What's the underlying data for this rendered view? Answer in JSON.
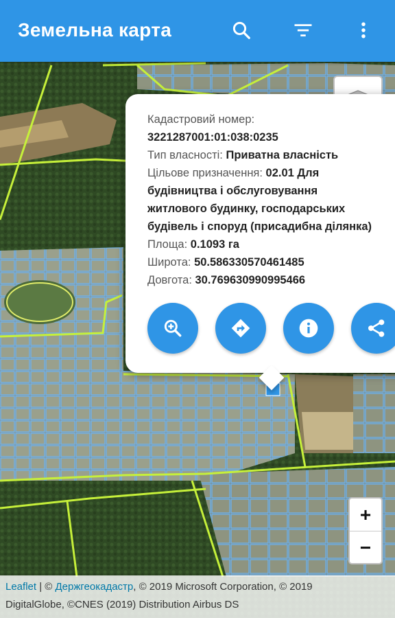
{
  "appbar": {
    "title": "Земельна карта",
    "icons": [
      "search-icon",
      "filter-icon",
      "more-vert-icon"
    ],
    "color": "#2f95e6"
  },
  "popup": {
    "cadastral_label": "Кадастровий номер:",
    "cadastral_number": "3221287001:01:038:0235",
    "ownership_label": "Тип власності:",
    "ownership_value": "Приватна власність",
    "purpose_label": "Цільове призначення:",
    "purpose_line1": "02.01 Для",
    "purpose_line2": "будівництва і обслуговування",
    "purpose_line3": "житлового будинку, господарських",
    "purpose_line4": "будівель і споруд (присадибна ділянка)",
    "area_label": "Площа:",
    "area_value": "0.1093 га",
    "lat_label": "Широта:",
    "lat_value": "50.586330570461485",
    "lon_label": "Довгота:",
    "lon_value": "30.769630990995466",
    "actions": [
      "zoom-in-icon",
      "directions-icon",
      "info-icon",
      "share-icon"
    ]
  },
  "zoom": {
    "plus": "+",
    "minus": "−"
  },
  "attribution": {
    "leaflet": "Leaflet",
    "sep": " | © ",
    "provider": "Держгеокадастр",
    "rest1": ", © 2019 Microsoft Corporation, © 2019",
    "rest2": "DigitalGlobe, ©CNES (2019) Distribution Airbus DS"
  }
}
